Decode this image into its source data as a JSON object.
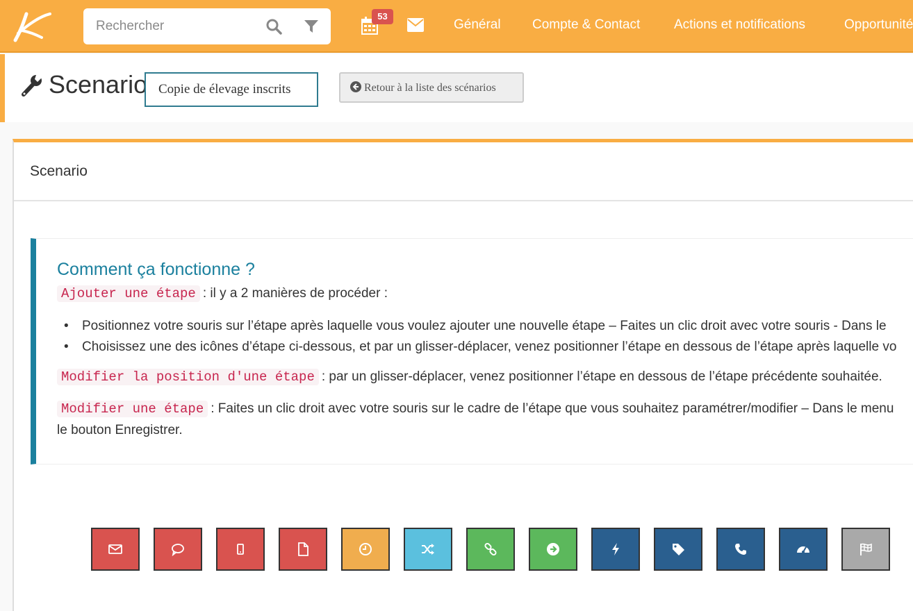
{
  "search": {
    "placeholder": "Rechercher"
  },
  "notifications": {
    "calendar_count": "53"
  },
  "nav": [
    "Général",
    "Compte & Contact",
    "Actions et notifications",
    "Opportunités"
  ],
  "header": {
    "title": "Scenario",
    "name_value": "Copie de élevage inscrits",
    "back_label": "Retour à la liste des scénarios"
  },
  "panel": {
    "title": "Scenario",
    "help": {
      "title": "Comment ça fonctionne ?",
      "add_code": "Ajouter une étape",
      "add_text": ": il y a 2 manières de procéder :",
      "bullet1": "Positionnez votre souris sur l’étape après laquelle vous voulez ajouter une nouvelle étape – Faites un clic droit avec votre souris - Dans le",
      "bullet2": "Choisissez une des icônes d’étape ci-dessous, et par un glisser-déplacer, venez positionner l’étape en dessous de l’étape après laquelle vo",
      "move_code": "Modifier la position d'une étape",
      "move_text": ": par un glisser-déplacer, venez positionner l’étape en dessous de l’étape précédente souhaitée.",
      "edit_code": "Modifier une étape",
      "edit_text": ": Faites un clic droit avec votre souris sur le cadre de l’étape que vous souhaitez paramétrer/modifier – Dans le menu",
      "edit_text2": "le bouton Enregistrer."
    }
  },
  "steps": [
    {
      "icon": "envelope-icon",
      "color": "#d9534f"
    },
    {
      "icon": "comment-icon",
      "color": "#d9534f"
    },
    {
      "icon": "mobile-icon",
      "color": "#d9534f"
    },
    {
      "icon": "file-icon",
      "color": "#d9534f"
    },
    {
      "icon": "clock-icon",
      "color": "#f0ad4e"
    },
    {
      "icon": "random-icon",
      "color": "#5bc0de"
    },
    {
      "icon": "link-icon",
      "color": "#5cb85c"
    },
    {
      "icon": "arrow-right-icon",
      "color": "#5cb85c"
    },
    {
      "icon": "bolt-icon",
      "color": "#2a5f8f"
    },
    {
      "icon": "tag-icon",
      "color": "#2a5f8f"
    },
    {
      "icon": "phone-icon",
      "color": "#2a5f8f"
    },
    {
      "icon": "dashboard-icon",
      "color": "#2a5f8f"
    },
    {
      "icon": "flag-checkered-icon",
      "color": "#a9a9a9"
    }
  ],
  "colors": {
    "brand": "#f9ad43",
    "info": "#1b809e",
    "code": "#c7254e"
  }
}
